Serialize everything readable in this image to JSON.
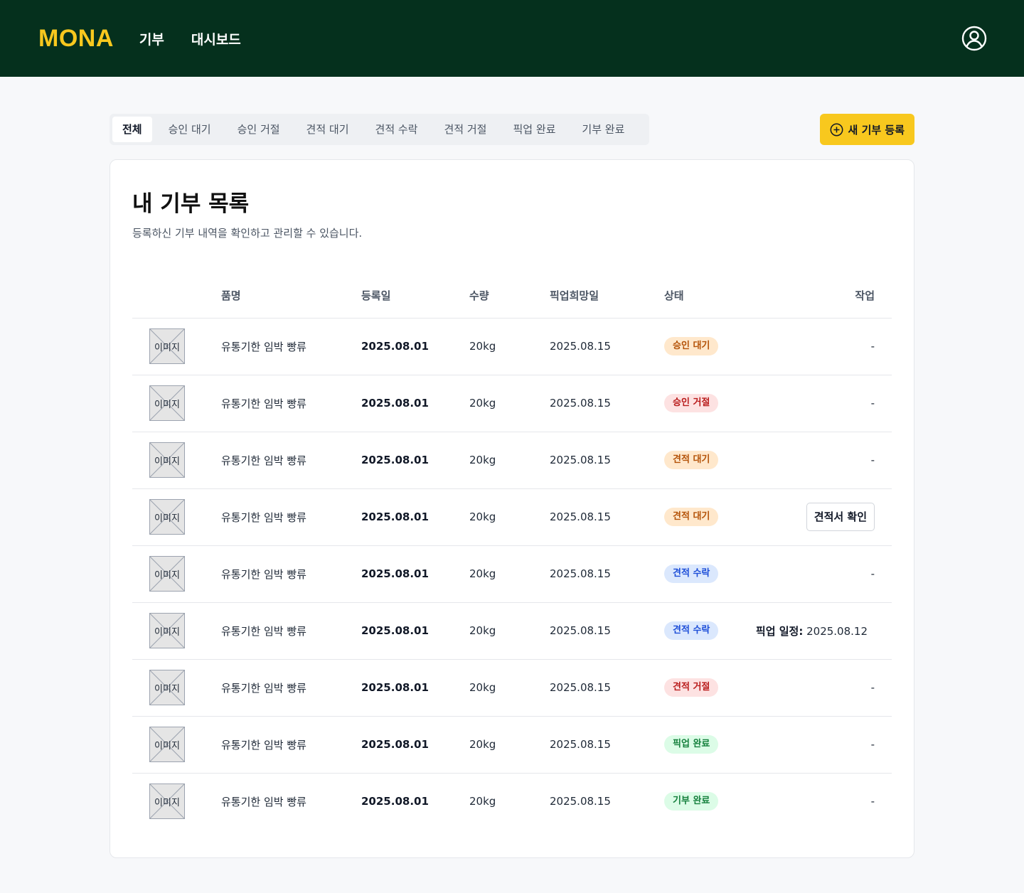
{
  "header": {
    "logo": "MONA",
    "nav": [
      {
        "label": "기부"
      },
      {
        "label": "대시보드"
      }
    ]
  },
  "tabs": [
    {
      "label": "전체",
      "active": true
    },
    {
      "label": "승인 대기",
      "active": false
    },
    {
      "label": "승인 거절",
      "active": false
    },
    {
      "label": "견적 대기",
      "active": false
    },
    {
      "label": "견적 수락",
      "active": false
    },
    {
      "label": "견적 거절",
      "active": false
    },
    {
      "label": "픽업 완료",
      "active": false
    },
    {
      "label": "기부 완료",
      "active": false
    }
  ],
  "new_button": {
    "label": "새 기부 등록",
    "icon": "plus-circle-icon"
  },
  "page": {
    "title": "내 기부 목록",
    "subtitle": "등록하신 기부 내역을 확인하고 관리할 수 있습니다."
  },
  "table": {
    "headers": [
      "",
      "품명",
      "등록일",
      "수량",
      "픽업희망일",
      "상태",
      "작업"
    ],
    "image_placeholder": "이미지",
    "rows": [
      {
        "name": "유통기한 임박 빵류",
        "reg_date": "2025.08.01",
        "qty": "20kg",
        "pickup_date": "2025.08.15",
        "status": "승인 대기",
        "status_type": "orange",
        "action_type": "text",
        "action": "-"
      },
      {
        "name": "유통기한 임박 빵류",
        "reg_date": "2025.08.01",
        "qty": "20kg",
        "pickup_date": "2025.08.15",
        "status": "승인 거절",
        "status_type": "red",
        "action_type": "text",
        "action": "-"
      },
      {
        "name": "유통기한 임박 빵류",
        "reg_date": "2025.08.01",
        "qty": "20kg",
        "pickup_date": "2025.08.15",
        "status": "견적 대기",
        "status_type": "orange",
        "action_type": "text",
        "action": "-"
      },
      {
        "name": "유통기한 임박 빵류",
        "reg_date": "2025.08.01",
        "qty": "20kg",
        "pickup_date": "2025.08.15",
        "status": "견적 대기",
        "status_type": "orange",
        "action_type": "button",
        "action": "견적서 확인"
      },
      {
        "name": "유통기한 임박 빵류",
        "reg_date": "2025.08.01",
        "qty": "20kg",
        "pickup_date": "2025.08.15",
        "status": "견적 수락",
        "status_type": "blue",
        "action_type": "text",
        "action": "-"
      },
      {
        "name": "유통기한 임박 빵류",
        "reg_date": "2025.08.01",
        "qty": "20kg",
        "pickup_date": "2025.08.15",
        "status": "견적 수락",
        "status_type": "blue",
        "action_type": "schedule",
        "action_label": "픽업 일정:",
        "action": "2025.08.12"
      },
      {
        "name": "유통기한 임박 빵류",
        "reg_date": "2025.08.01",
        "qty": "20kg",
        "pickup_date": "2025.08.15",
        "status": "견적 거절",
        "status_type": "red",
        "action_type": "text",
        "action": "-"
      },
      {
        "name": "유통기한 임박 빵류",
        "reg_date": "2025.08.01",
        "qty": "20kg",
        "pickup_date": "2025.08.15",
        "status": "픽업 완료",
        "status_type": "green",
        "action_type": "text",
        "action": "-"
      },
      {
        "name": "유통기한 임박 빵류",
        "reg_date": "2025.08.01",
        "qty": "20kg",
        "pickup_date": "2025.08.15",
        "status": "기부 완료",
        "status_type": "green",
        "action_type": "text",
        "action": "-"
      }
    ]
  },
  "colors": {
    "header_bg": "#05301d",
    "brand_yellow": "#f8c81e",
    "badge": {
      "orange": {
        "bg": "#ffe8cc",
        "fg": "#b45309"
      },
      "red": {
        "bg": "#fde2e2",
        "fg": "#b91c1c"
      },
      "blue": {
        "bg": "#dbe8fd",
        "fg": "#1d4ed8"
      },
      "green": {
        "bg": "#dcfce7",
        "fg": "#15803d"
      }
    }
  }
}
